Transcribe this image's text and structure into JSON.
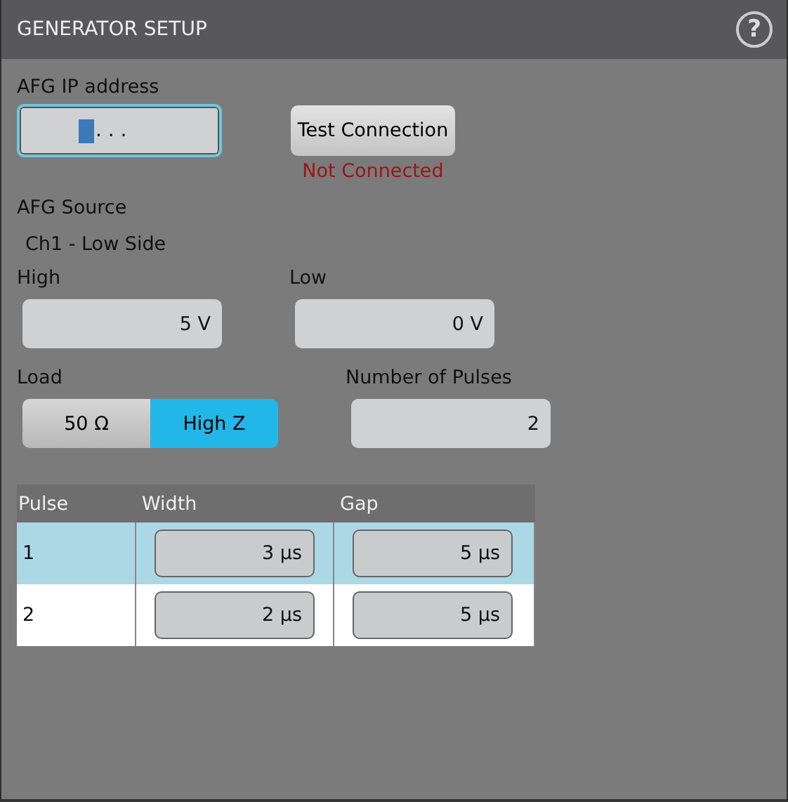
{
  "window": {
    "title": "GENERATOR SETUP",
    "help_icon": "?"
  },
  "ip": {
    "label": "AFG IP address",
    "value": ". . .",
    "focused": true
  },
  "test_button": "Test Connection",
  "status": "Not Connected",
  "source": {
    "label": "AFG Source",
    "value": "Ch1 - Low Side"
  },
  "high": {
    "label": "High",
    "value": "5 V"
  },
  "low": {
    "label": "Low",
    "value": "0 V"
  },
  "load": {
    "label": "Load",
    "options": [
      {
        "label": "50 Ω",
        "selected": false
      },
      {
        "label": "High Z",
        "selected": true
      }
    ]
  },
  "pulses": {
    "label": "Number of Pulses",
    "value": "2"
  },
  "table": {
    "columns": [
      "Pulse",
      "Width",
      "Gap"
    ],
    "rows": [
      {
        "pulse": "1",
        "width": "3 µs",
        "gap": "5 µs",
        "selected": true
      },
      {
        "pulse": "2",
        "width": "2 µs",
        "gap": "5 µs",
        "selected": false
      }
    ]
  }
}
